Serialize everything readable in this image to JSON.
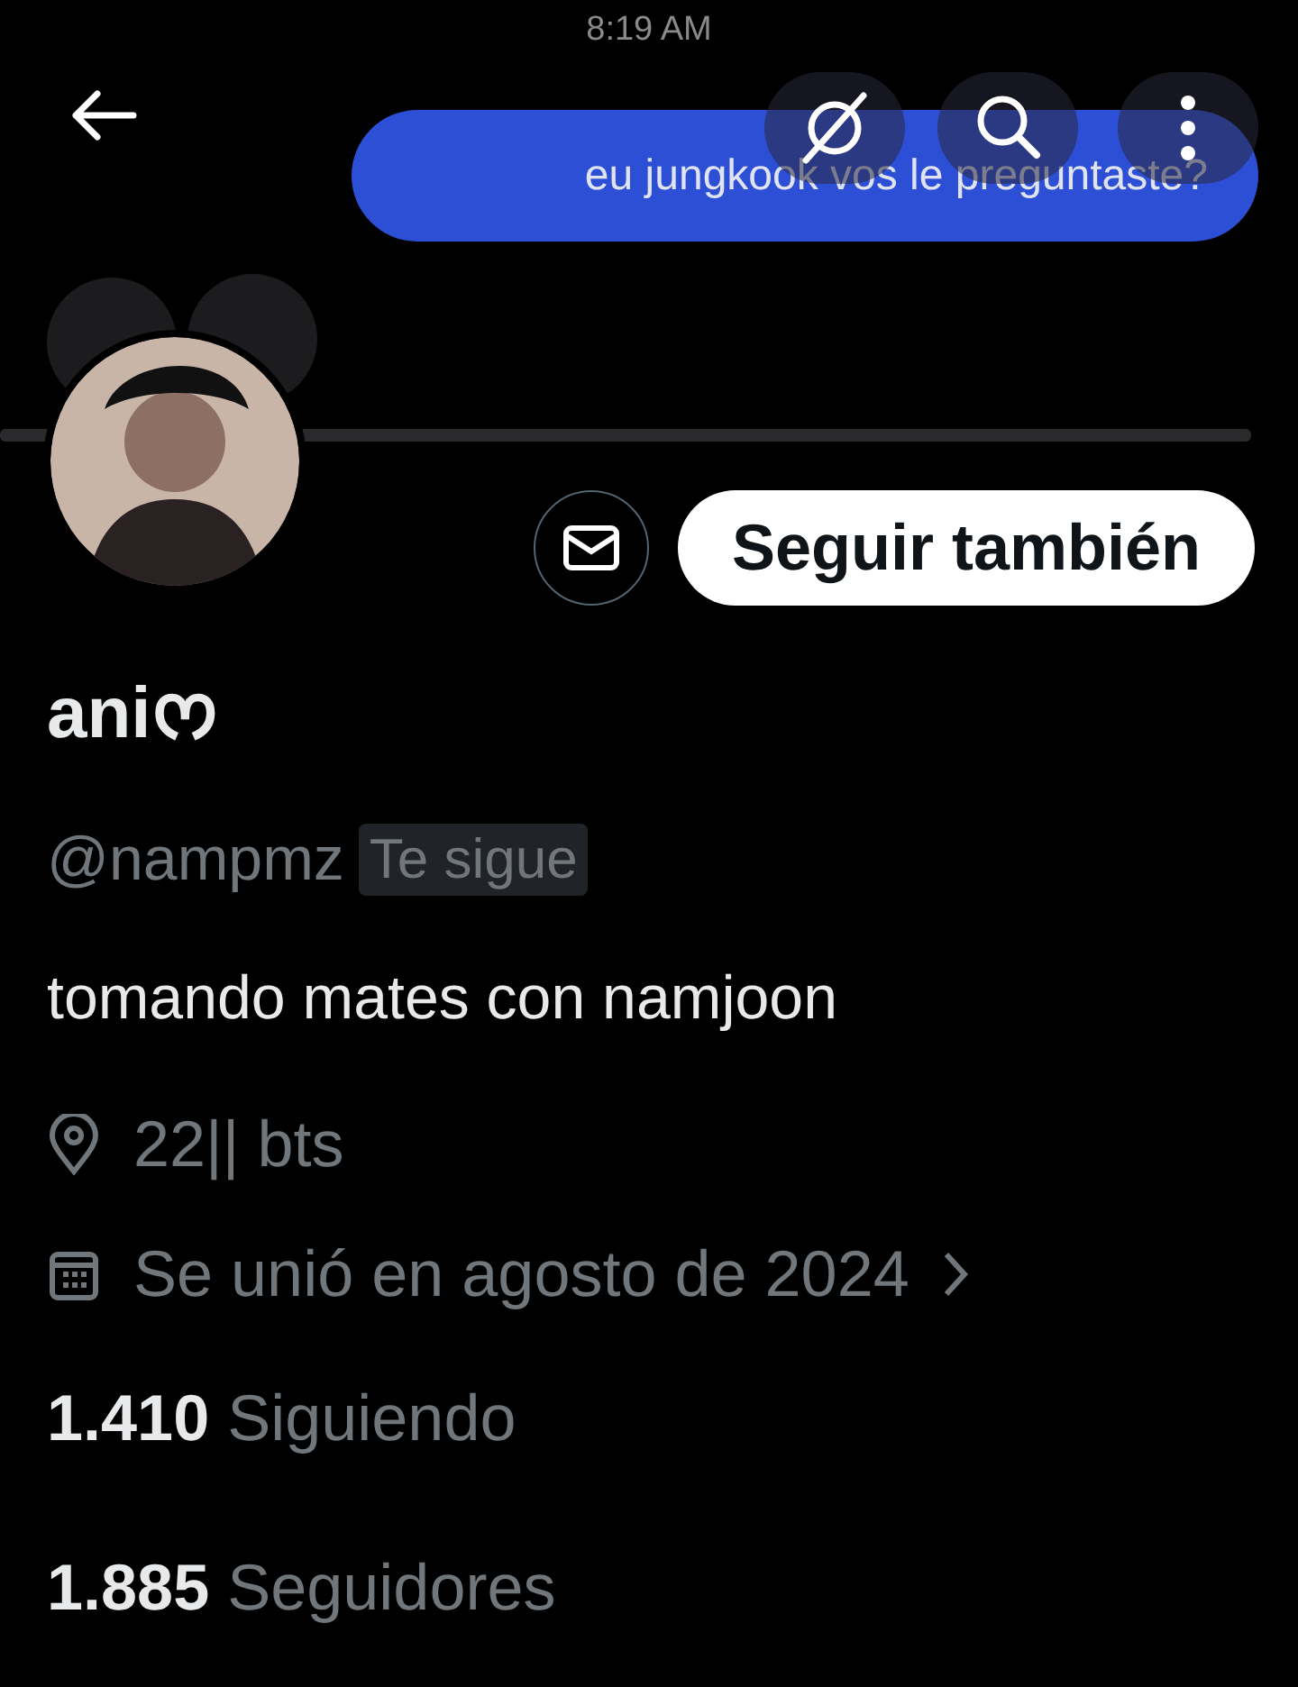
{
  "status_bar": {
    "time": "8:19 AM"
  },
  "header": {
    "banner": {
      "message": "eu jungkook vos le preguntaste?"
    }
  },
  "actions": {
    "follow_button": "Seguir también"
  },
  "profile": {
    "name": "aniᰔ",
    "handle": "@nampmz",
    "follows_you_badge": "Te sigue",
    "bio": "tomando mates con namjoon",
    "location": "22|| bts",
    "joined": "Se unió en agosto de 2024"
  },
  "stats": [
    {
      "count": "1.410",
      "label": "Siguiendo"
    },
    {
      "count": "1.885",
      "label": "Seguidores"
    }
  ]
}
